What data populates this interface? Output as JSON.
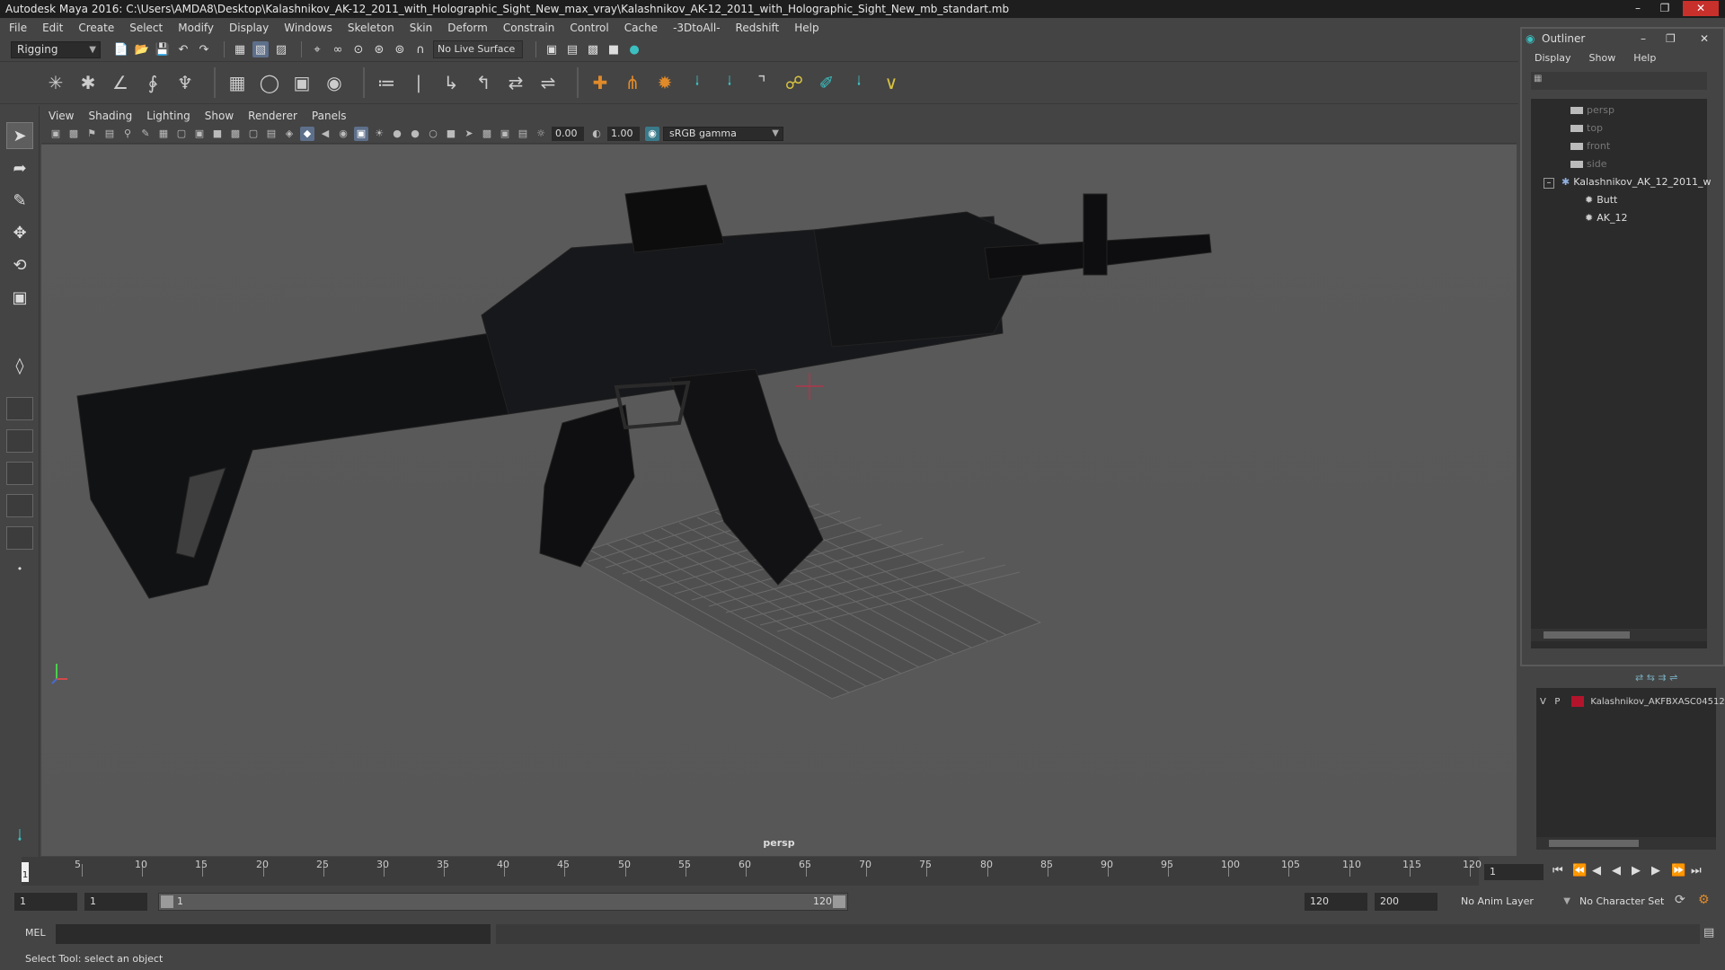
{
  "window": {
    "title": "Autodesk Maya 2016: C:\\Users\\AMDA8\\Desktop\\Kalashnikov_AK-12_2011_with_Holographic_Sight_New_max_vray\\Kalashnikov_AK-12_2011_with_Holographic_Sight_New_mb_standart.mb"
  },
  "menubar": [
    "File",
    "Edit",
    "Create",
    "Select",
    "Modify",
    "Display",
    "Windows",
    "Skeleton",
    "Skin",
    "Deform",
    "Constrain",
    "Control",
    "Cache",
    "-3DtoAll-",
    "Redshift",
    "Help"
  ],
  "statusline": {
    "menuset": "Rigging",
    "live_surface": "No Live Surface"
  },
  "viewport": {
    "menu": [
      "View",
      "Shading",
      "Lighting",
      "Show",
      "Renderer",
      "Panels"
    ],
    "near_value": "0.00",
    "far_value": "1.00",
    "color_space": "sRGB gamma",
    "camera_label": "persp"
  },
  "outliner": {
    "title": "Outliner",
    "menu": [
      "Display",
      "Show",
      "Help"
    ],
    "items": [
      {
        "label": "persp",
        "kind": "camera"
      },
      {
        "label": "top",
        "kind": "camera"
      },
      {
        "label": "front",
        "kind": "camera"
      },
      {
        "label": "side",
        "kind": "camera"
      },
      {
        "label": "Kalashnikov_AK_12_2011_w",
        "kind": "group"
      },
      {
        "label": "Butt",
        "kind": "mesh"
      },
      {
        "label": "AK_12",
        "kind": "mesh"
      }
    ]
  },
  "layers": {
    "row": {
      "v": "V",
      "p": "P",
      "name": "Kalashnikov_AKFBXASC04512",
      "color": "#b3142c"
    }
  },
  "timeslider": {
    "ticks": [
      "5",
      "10",
      "15",
      "20",
      "25",
      "30",
      "35",
      "40",
      "45",
      "50",
      "55",
      "60",
      "65",
      "70",
      "75",
      "80",
      "85",
      "90",
      "95",
      "100",
      "105",
      "110",
      "115",
      "120"
    ],
    "current_frame": "1",
    "current_field": "1"
  },
  "rangeslider": {
    "start": "1",
    "playback_start": "1",
    "range_start_label": "1",
    "range_end_label": "120",
    "playback_end": "120",
    "end": "200",
    "anim_layer": "No Anim Layer",
    "character_set": "No Character Set"
  },
  "cmdline": {
    "label": "MEL"
  },
  "helpline": "Select Tool: select an object"
}
